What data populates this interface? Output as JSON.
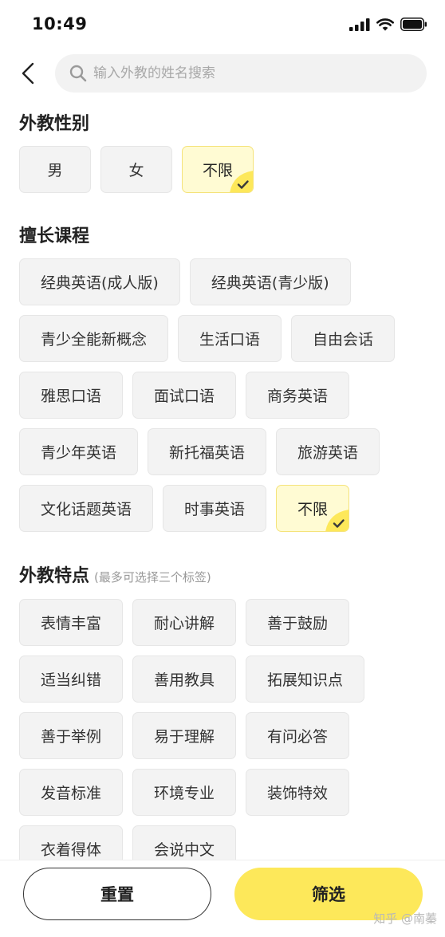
{
  "status_bar": {
    "time": "10:49"
  },
  "search": {
    "placeholder": "输入外教的姓名搜索"
  },
  "sections": {
    "gender": {
      "title": "外教性别",
      "options": [
        "男",
        "女",
        "不限"
      ]
    },
    "courses": {
      "title": "擅长课程",
      "options": [
        "经典英语(成人版)",
        "经典英语(青少版)",
        "青少全能新概念",
        "生活口语",
        "自由会话",
        "雅思口语",
        "面试口语",
        "商务英语",
        "青少年英语",
        "新托福英语",
        "旅游英语",
        "文化话题英语",
        "时事英语",
        "不限"
      ]
    },
    "features": {
      "title": "外教特点",
      "note": "(最多可选择三个标签)",
      "options": [
        "表情丰富",
        "耐心讲解",
        "善于鼓励",
        "适当纠错",
        "善用教具",
        "拓展知识点",
        "善于举例",
        "易于理解",
        "有问必答",
        "发音标准",
        "环境专业",
        "装饰特效",
        "衣着得体",
        "会说中文"
      ]
    }
  },
  "buttons": {
    "reset": "重置",
    "filter": "筛选"
  },
  "watermark": "知乎 @南蓁",
  "colors": {
    "accent": "#fde85a",
    "selected_bg": "#fffbd3",
    "selected_border": "#f5e37a",
    "check": "#3a3a3a"
  }
}
